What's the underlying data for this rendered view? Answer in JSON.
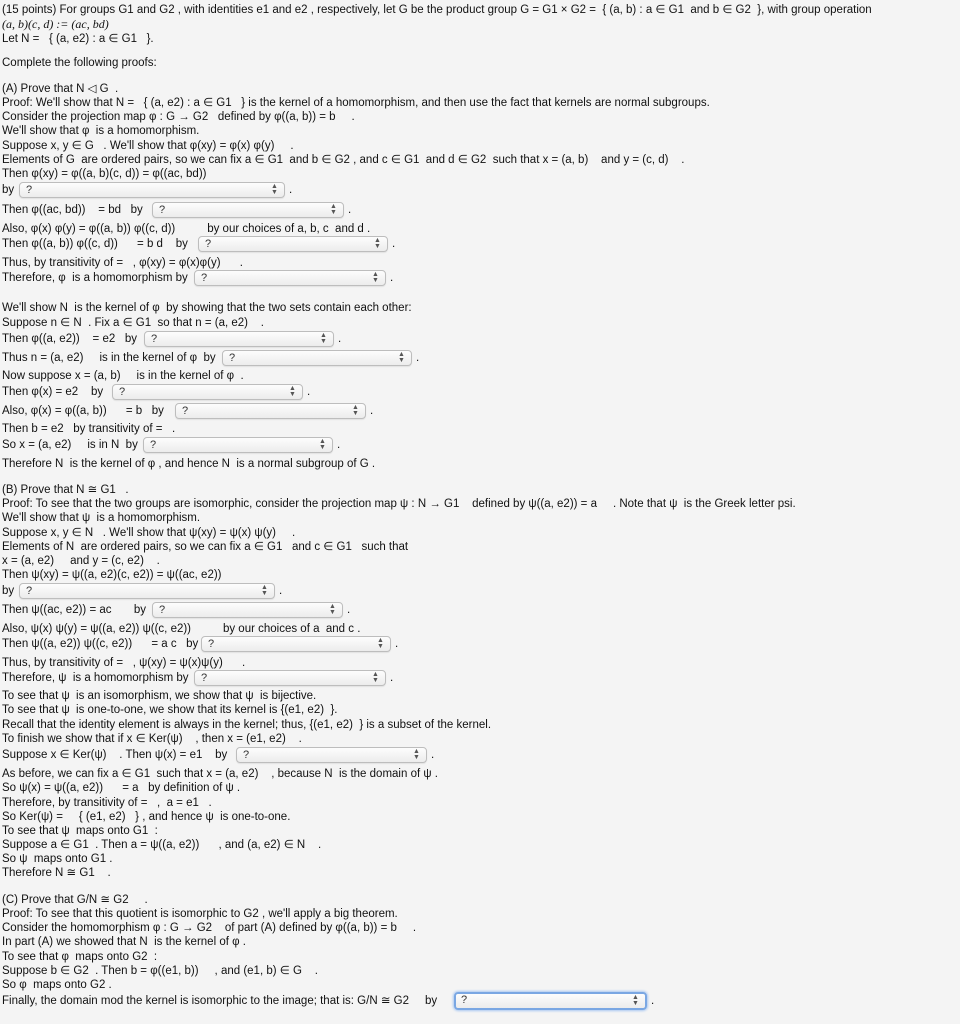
{
  "intro": {
    "line1": "(15 points) For groups G1 and G2 , with identities e1 and e2 , respectively, let G be the product group G = G1 × G2 =  { (a, b) : a ∈ G1  and b ∈ G2  }, with group operation",
    "line2": "(a, b)(c, d) := (ac, bd)",
    "line3": "Let N =   { (a, e2) : a ∈ G1   }.",
    "instructions": "Complete the following proofs:"
  },
  "partA": {
    "lines": [
      "(A) Prove that N ◁ G  .",
      "Proof: We'll show that N =   { (a, e2) : a ∈ G1   } is the kernel of a homomorphism, and then use the fact that kernels are normal subgroups.",
      "Consider the projection map φ : G → G2   defined by φ((a, b)) = b     .",
      "We'll show that φ  is a homomorphism.",
      "Suppose x, y ∈ G   . We'll show that φ(xy) = φ(x) φ(y)     .",
      "Elements of G  are ordered pairs, so we can fix a ∈ G1  and b ∈ G2 , and c ∈ G1  and d ∈ G2  such that x = (a, b)    and y = (c, d)    .",
      "Then φ(xy) = φ((a, b)(c, d)) = φ((ac, bd))",
      "by",
      "Then φ((ac, bd))    = bd   by",
      "Also, φ(x) φ(y) = φ((a, b)) φ((c, d))          by our choices of a, b, c  and d .",
      "Then φ((a, b)) φ((c, d))      = b d    by",
      "Thus, by transitivity of =   , φ(xy) = φ(x)φ(y)      .",
      "Therefore, φ  is a homomorphism by",
      "We'll show N  is the kernel of φ  by showing that the two sets contain each other:",
      "Suppose n ∈ N  . Fix a ∈ G1  so that n = (a, e2)    .",
      "Then φ((a, e2))    = e2   by",
      "Thus n = (a, e2)     is in the kernel of φ  by",
      "Now suppose x = (a, b)     is in the kernel of φ  .",
      "Then φ(x) = e2    by",
      "Also, φ(x) = φ((a, b))      = b   by",
      "Then b = e2   by transitivity of =   .",
      "So x = (a, e2)     is in N  by",
      "Therefore N  is the kernel of φ , and hence N  is a normal subgroup of G ."
    ]
  },
  "partB": {
    "lines": [
      "(B) Prove that N ≅ G1   .",
      "Proof: To see that the two groups are isomorphic, consider the projection map ψ : N → G1    defined by ψ((a, e2)) = a     . Note that ψ  is the Greek letter psi.",
      "We'll show that ψ  is a homomorphism.",
      "Suppose x, y ∈ N   . We'll show that ψ(xy) = ψ(x) ψ(y)     .",
      "Elements of N  are ordered pairs, so we can fix a ∈ G1   and c ∈ G1   such that",
      "x = (a, e2)     and y = (c, e2)    .",
      "Then ψ(xy) = ψ((a, e2)(c, e2)) = ψ((ac, e2))",
      "by",
      "Then ψ((ac, e2)) = ac       by",
      "Also, ψ(x) ψ(y) = ψ((a, e2)) ψ((c, e2))          by our choices of a  and c .",
      "Then ψ((a, e2)) ψ((c, e2))      = a c   by",
      "Thus, by transitivity of =   , ψ(xy) = ψ(x)ψ(y)      .",
      "Therefore, ψ  is a homomorphism by",
      "To see that ψ  is an isomorphism, we show that ψ  is bijective.",
      "To see that ψ  is one-to-one, we show that its kernel is {(e1, e2)  }.",
      "Recall that the identity element is always in the kernel; thus, {(e1, e2)  } is a subset of the kernel.",
      "To finish we show that if x ∈ Ker(ψ)    , then x = (e1, e2)    .",
      "Suppose x ∈ Ker(ψ)    . Then ψ(x) = e1    by",
      "As before, we can fix a ∈ G1  such that x = (a, e2)    , because N  is the domain of ψ .",
      "So ψ(x) = ψ((a, e2))      = a   by definition of ψ .",
      "Therefore, by transitivity of =   ,  a = e1   .",
      "So Ker(ψ) =     { (e1, e2)   } , and hence ψ  is one-to-one.",
      "To see that ψ  maps onto G1  :",
      "Suppose a ∈ G1  . Then a = ψ((a, e2))      , and (a, e2) ∈ N    .",
      "So ψ  maps onto G1 .",
      "Therefore N ≅ G1    ."
    ]
  },
  "partC": {
    "lines": [
      "(C) Prove that G/N ≅ G2     .",
      "Proof: To see that this quotient is isomorphic to G2 , we'll apply a big theorem.",
      "Consider the homomorphism φ : G → G2    of part (A) defined by φ((a, b)) = b     .",
      "In part (A) we showed that N  is the kernel of φ .",
      "To see that φ  maps onto G2  :",
      "Suppose b ∈ G2  . Then b = φ((e1, b))     , and (e1, b) ∈ G    .",
      "So φ  maps onto G2 .",
      "Finally, the domain mod the kernel is isomorphic to the image; that is: G/N ≅ G2     by"
    ]
  },
  "selects": {
    "placeholder": "?",
    "arrow_icon": "⬍",
    "trailing": "."
  }
}
